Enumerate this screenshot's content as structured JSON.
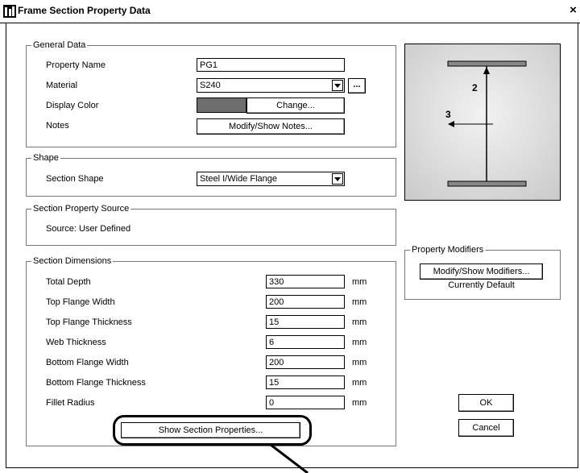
{
  "window": {
    "title": "Frame Section Property Data",
    "close_glyph": "×"
  },
  "general": {
    "title": "General Data",
    "property_name_label": "Property Name",
    "property_name_value": "PG1",
    "material_label": "Material",
    "material_value": "S240",
    "material_more": "...",
    "display_color_label": "Display Color",
    "display_color_swatch": "#6e6e6e",
    "change_button": "Change...",
    "notes_label": "Notes",
    "notes_button": "Modify/Show Notes..."
  },
  "shape": {
    "title": "Shape",
    "section_shape_label": "Section Shape",
    "section_shape_value": "Steel I/Wide Flange"
  },
  "source": {
    "title": "Section Property Source",
    "text": "Source:  User Defined"
  },
  "dimensions": {
    "title": "Section Dimensions",
    "rows": [
      {
        "label": "Total Depth",
        "value": "330",
        "unit": "mm"
      },
      {
        "label": "Top Flange Width",
        "value": "200",
        "unit": "mm"
      },
      {
        "label": "Top Flange Thickness",
        "value": "15",
        "unit": "mm"
      },
      {
        "label": "Web Thickness",
        "value": "6",
        "unit": "mm"
      },
      {
        "label": "Bottom Flange Width",
        "value": "200",
        "unit": "mm"
      },
      {
        "label": "Bottom Flange Thickness",
        "value": "15",
        "unit": "mm"
      },
      {
        "label": "Fillet Radius",
        "value": "0",
        "unit": "mm"
      }
    ],
    "show_properties_button": "Show Section Properties..."
  },
  "preview": {
    "axis2_label": "2",
    "axis3_label": "3"
  },
  "modifiers": {
    "title": "Property Modifiers",
    "button": "Modify/Show Modifiers...",
    "status": "Currently Default"
  },
  "actions": {
    "ok": "OK",
    "cancel": "Cancel"
  }
}
